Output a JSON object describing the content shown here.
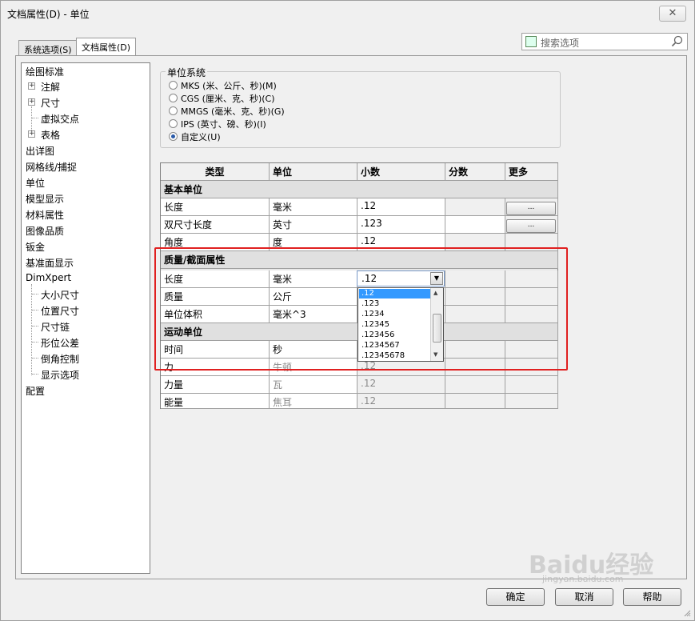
{
  "window": {
    "title": "文档属性(D) - 单位",
    "close_icon": "close-icon"
  },
  "tabs": [
    {
      "label": "系统选项(S)"
    },
    {
      "label": "文档属性(D)"
    }
  ],
  "search": {
    "placeholder": "搜索选项"
  },
  "tree": {
    "items": [
      {
        "label": "绘图标准"
      },
      {
        "label": "注解"
      },
      {
        "label": "尺寸"
      },
      {
        "label": "虚拟交点"
      },
      {
        "label": "表格"
      },
      {
        "label": "出详图"
      },
      {
        "label": "网格线/捕捉"
      },
      {
        "label": "单位"
      },
      {
        "label": "模型显示"
      },
      {
        "label": "材料属性"
      },
      {
        "label": "图像品质"
      },
      {
        "label": "钣金"
      },
      {
        "label": "基准面显示"
      },
      {
        "label": "DimXpert"
      },
      {
        "label": "大小尺寸"
      },
      {
        "label": "位置尺寸"
      },
      {
        "label": "尺寸链"
      },
      {
        "label": "形位公差"
      },
      {
        "label": "倒角控制"
      },
      {
        "label": "显示选项"
      },
      {
        "label": "配置"
      }
    ]
  },
  "unit_system": {
    "label": "单位系统",
    "options": [
      {
        "label": "MKS (米、公斤、秒)(M)",
        "selected": false
      },
      {
        "label": "CGS (厘米、克、秒)(C)",
        "selected": false
      },
      {
        "label": "MMGS (毫米、克、秒)(G)",
        "selected": false
      },
      {
        "label": "IPS (英寸、磅、秒)(I)",
        "selected": false
      },
      {
        "label": "自定义(U)",
        "selected": true
      }
    ]
  },
  "grid": {
    "headers": [
      "类型",
      "单位",
      "小数",
      "分数",
      "更多"
    ],
    "sections": {
      "basic": "基本单位",
      "mass": "质量/截面属性",
      "motion": "运动单位"
    },
    "rows": {
      "length": {
        "type": "长度",
        "unit": "毫米",
        "decimal": ".12",
        "more": "..."
      },
      "dual": {
        "type": "双尺寸长度",
        "unit": "英寸",
        "decimal": ".123",
        "more": "..."
      },
      "angle": {
        "type": "角度",
        "unit": "度",
        "decimal": ".12"
      },
      "mlength": {
        "type": "长度",
        "unit": "毫米",
        "decimal": ".12"
      },
      "mass": {
        "type": "质量",
        "unit": "公斤"
      },
      "volume": {
        "type": "单位体积",
        "unit": "毫米^3"
      },
      "time": {
        "type": "时间",
        "unit": "秒"
      },
      "force": {
        "type": "力",
        "unit": "牛顿",
        "decimal": ".12"
      },
      "power": {
        "type": "力量",
        "unit": "瓦",
        "decimal": ".12"
      },
      "energy": {
        "type": "能量",
        "unit": "焦耳",
        "decimal": ".12"
      }
    }
  },
  "dropdown": {
    "options": [
      ".12",
      ".123",
      ".1234",
      ".12345",
      ".123456",
      ".1234567",
      ".12345678"
    ],
    "selected": ".12"
  },
  "buttons": {
    "ok": "确定",
    "cancel": "取消",
    "help": "帮助"
  },
  "watermark": {
    "brand": "Baidu经验",
    "url": "jingyan.baidu.com"
  },
  "colors": {
    "highlight": "#e02020",
    "selection": "#3399ff"
  }
}
